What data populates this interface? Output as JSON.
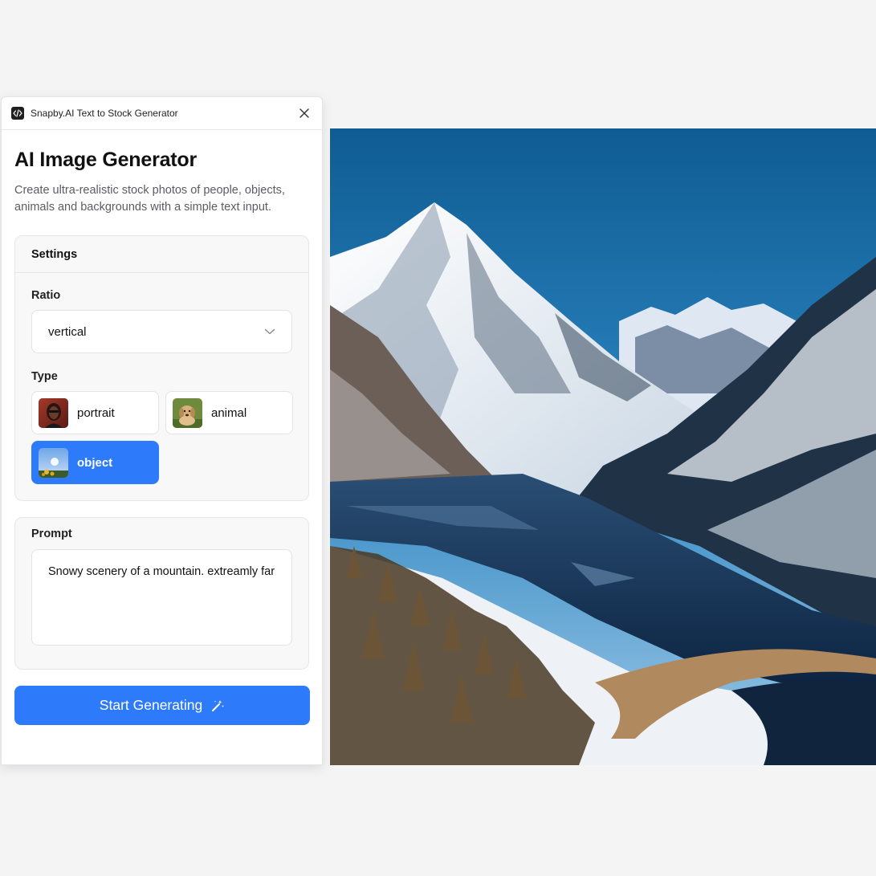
{
  "window": {
    "title": "Snapby.AI Text to Stock Generator"
  },
  "header": {
    "title": "AI Image Generator",
    "description": "Create ultra-realistic stock photos of people, objects, animals and backgrounds with a simple text input."
  },
  "settings": {
    "heading": "Settings",
    "ratio": {
      "label": "Ratio",
      "value": "vertical"
    },
    "type": {
      "label": "Type",
      "options": [
        {
          "label": "portrait"
        },
        {
          "label": "animal"
        },
        {
          "label": "object",
          "selected": true
        }
      ]
    }
  },
  "prompt": {
    "label": "Prompt",
    "value": "Snowy scenery of a mountain. extreamly far"
  },
  "generate": {
    "label": "Start Generating"
  },
  "colors": {
    "accent": "#2d7bfa",
    "background": "#f4f4f5"
  },
  "icons": [
    "code-icon",
    "close-icon",
    "chevron-down-icon",
    "magic-wand-icon"
  ]
}
